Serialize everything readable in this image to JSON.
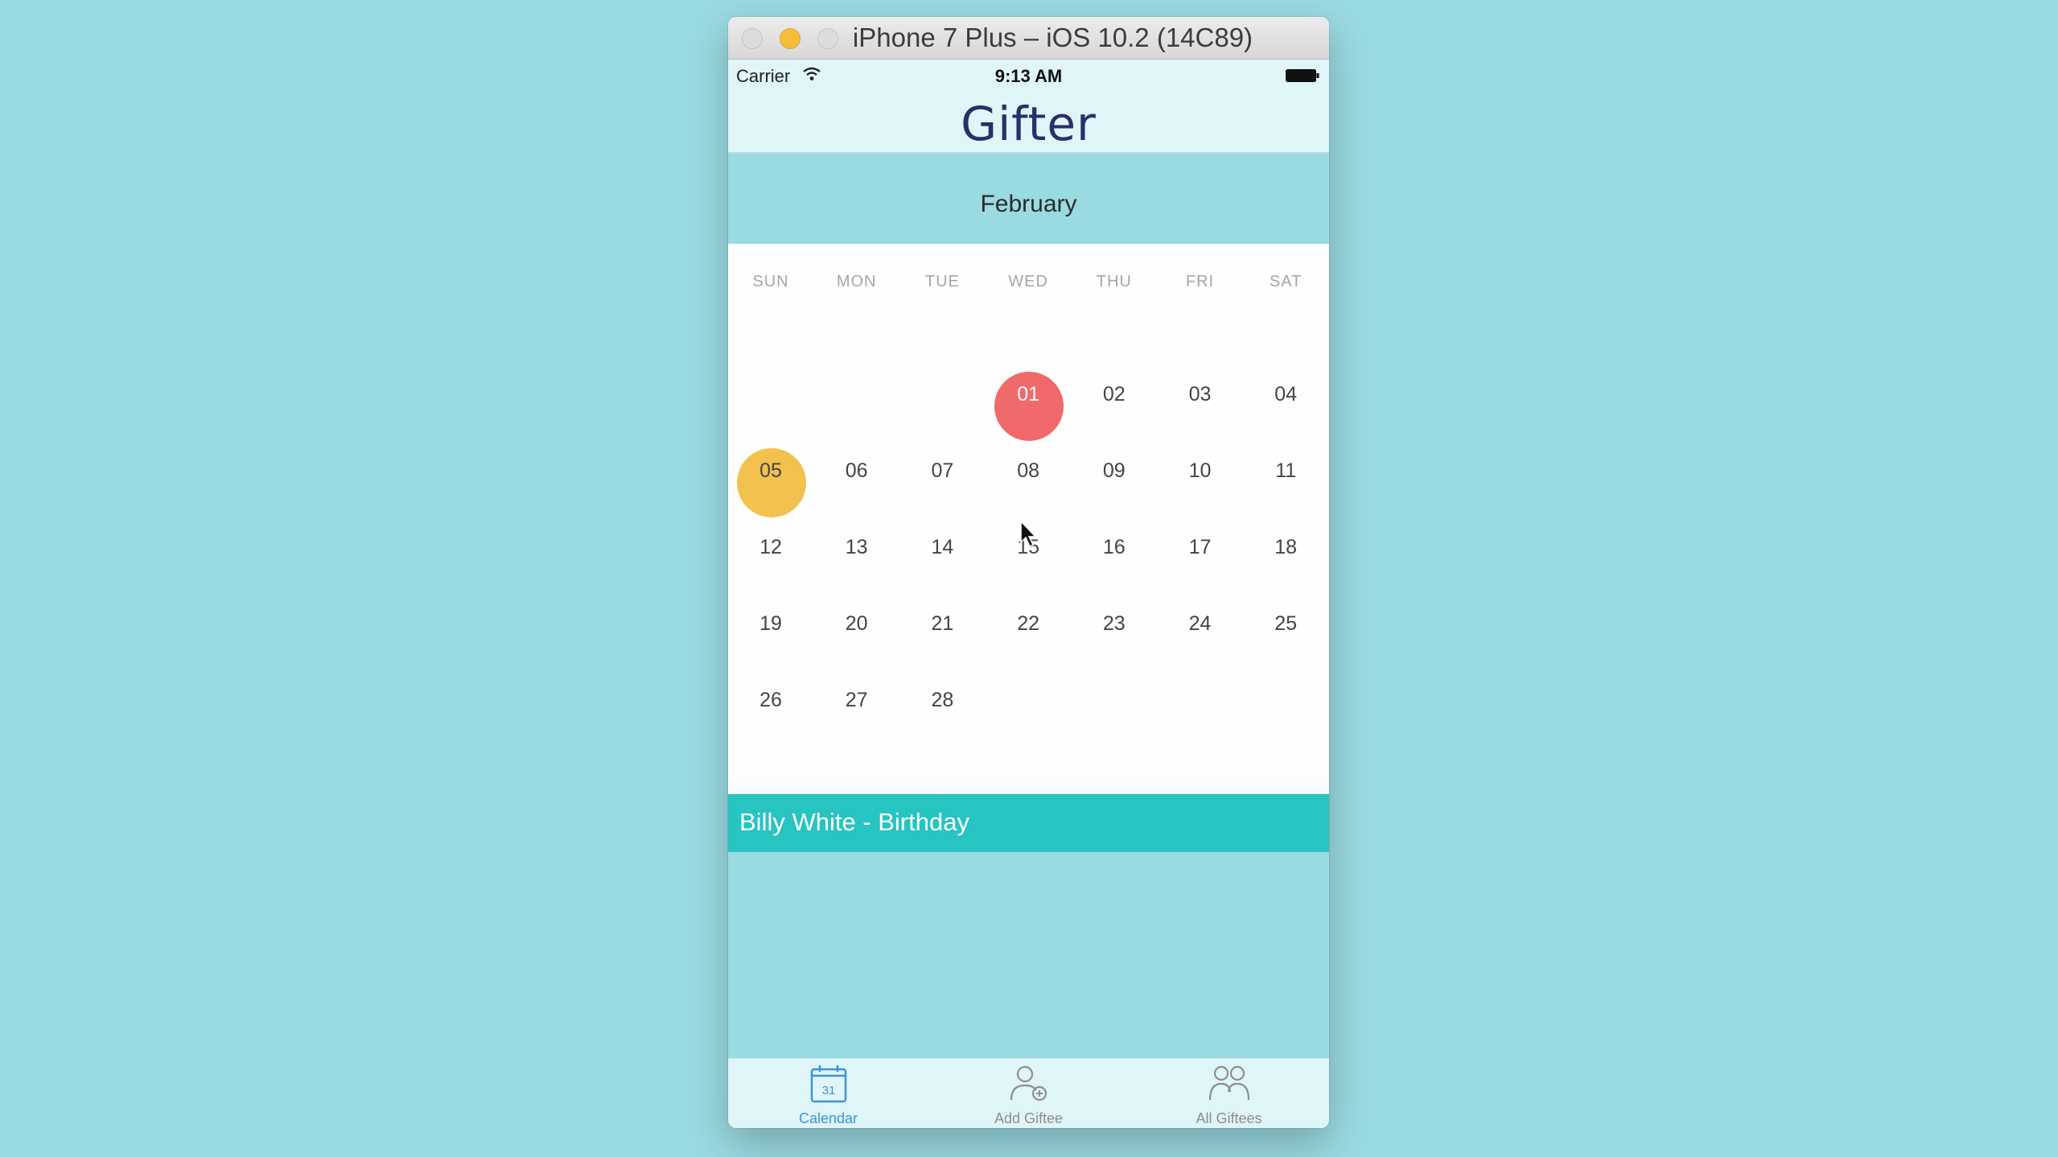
{
  "window": {
    "title": "iPhone 7 Plus – iOS 10.2 (14C89)"
  },
  "status_bar": {
    "carrier": "Carrier",
    "time": "9:13 AM",
    "icons": [
      "wifi-icon",
      "battery-icon"
    ]
  },
  "nav": {
    "title": "Gifter"
  },
  "calendar": {
    "month": "February",
    "weekdays": [
      "SUN",
      "MON",
      "TUE",
      "WED",
      "THU",
      "FRI",
      "SAT"
    ],
    "first_weekday_index": 3,
    "days": [
      "01",
      "02",
      "03",
      "04",
      "05",
      "06",
      "07",
      "08",
      "09",
      "10",
      "11",
      "12",
      "13",
      "14",
      "15",
      "16",
      "17",
      "18",
      "19",
      "20",
      "21",
      "22",
      "23",
      "24",
      "25",
      "26",
      "27",
      "28"
    ],
    "highlights": [
      {
        "day": "01",
        "color": "#f06a6c",
        "text_color": "#ffffff"
      },
      {
        "day": "05",
        "color": "#f2c14e",
        "text_color": "#444444"
      }
    ]
  },
  "event": {
    "label": "Billy White - Birthday",
    "color": "#27c4c1"
  },
  "tab_bar": {
    "tabs": [
      {
        "label": "Calendar",
        "icon": "calendar-icon",
        "badge": "31",
        "active": true
      },
      {
        "label": "Add Giftee",
        "icon": "add-person-icon",
        "active": false
      },
      {
        "label": "All Giftees",
        "icon": "people-icon",
        "active": false
      }
    ],
    "active_color": "#3b93dc"
  },
  "colors": {
    "background": "#9adae1",
    "navbar": "#dff5f8",
    "title": "#2a2f6a"
  }
}
